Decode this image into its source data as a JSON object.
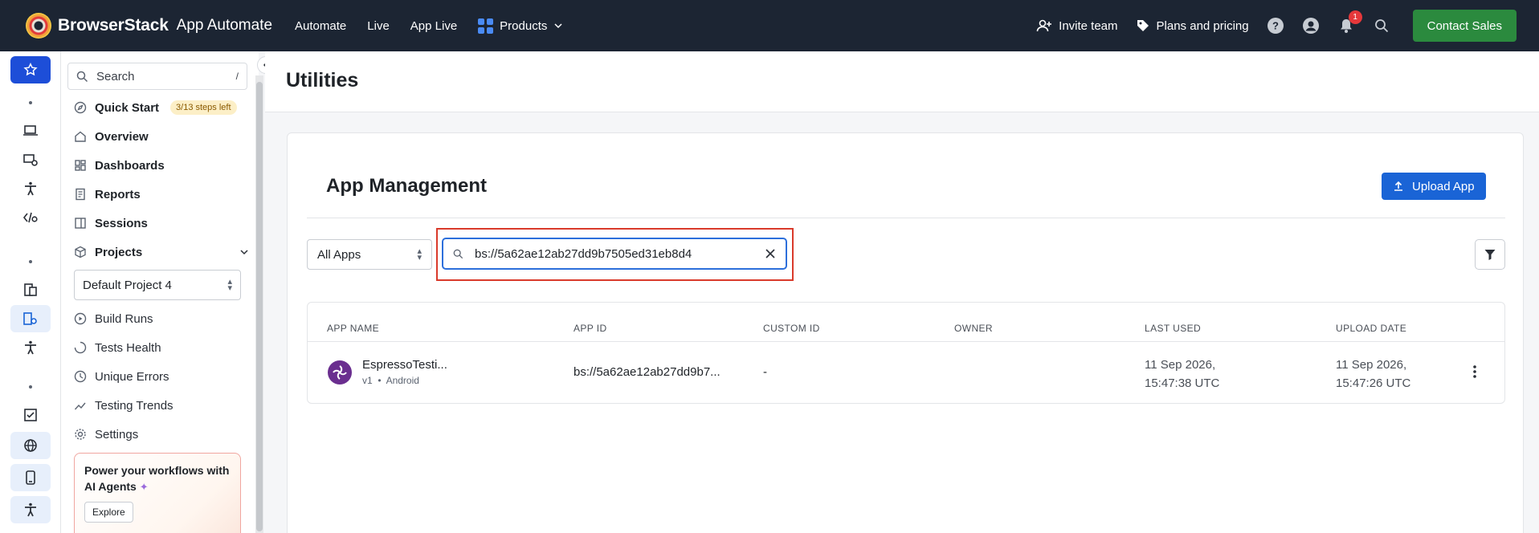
{
  "topnav": {
    "brand": "BrowserStack",
    "product": "App Automate",
    "links": [
      "Automate",
      "Live",
      "App Live"
    ],
    "products_label": "Products",
    "invite_label": "Invite team",
    "plans_label": "Plans and pricing",
    "notification_count": "1",
    "contact_label": "Contact Sales",
    "colors": {
      "bar": "#1c2533",
      "contact": "#2b8a3e"
    }
  },
  "sidebar": {
    "search_label": "Search",
    "search_shortcut": "/",
    "quick_start": "Quick Start",
    "steps_badge": "3/13 steps left",
    "items": {
      "overview": "Overview",
      "dashboards": "Dashboards",
      "reports": "Reports",
      "sessions": "Sessions",
      "projects": "Projects",
      "build_runs": "Build Runs",
      "tests_health": "Tests Health",
      "unique_errors": "Unique Errors",
      "testing_trends": "Testing Trends",
      "settings": "Settings"
    },
    "project_selected": "Default Project 4",
    "promo_text": "Power your workflows with AI Agents",
    "explore_label": "Explore"
  },
  "main": {
    "page_title": "Utilities",
    "card_title": "App Management",
    "upload_label": "Upload App",
    "apps_filter": "All Apps",
    "search_value": "bs://5a62ae12ab27dd9b7505ed31eb8d4",
    "table": {
      "headers": [
        "APP NAME",
        "APP ID",
        "CUSTOM ID",
        "OWNER",
        "LAST USED",
        "UPLOAD DATE"
      ],
      "rows": [
        {
          "app_name": "EspressoTesti...",
          "version": "v1",
          "platform": "Android",
          "app_id": "bs://5a62ae12ab27dd9b7...",
          "custom_id": "-",
          "owner": "",
          "last_used_date": "11 Sep 2026,",
          "last_used_time": "15:47:38 UTC",
          "upload_date": "11 Sep 2026,",
          "upload_time": "15:47:26 UTC"
        }
      ]
    }
  }
}
